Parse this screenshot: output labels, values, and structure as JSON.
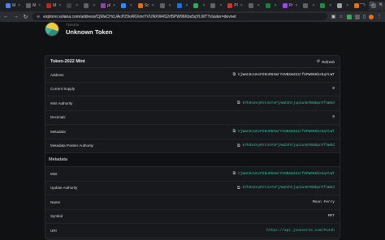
{
  "browser": {
    "tabs": [
      {
        "label": "M",
        "color": "#4285f4"
      },
      {
        "label": "M",
        "color": "#5f6368"
      },
      {
        "label": "M",
        "color": "#c5221f"
      },
      {
        "label": "",
        "color": "#3c4043"
      },
      {
        "label": "",
        "color": "#5f6368"
      },
      {
        "label": "pl",
        "color": "#8e44ad"
      },
      {
        "label": "",
        "color": "#2d8cff"
      },
      {
        "label": "Sc",
        "color": "#e37400"
      },
      {
        "label": "",
        "color": "#5f6368"
      },
      {
        "label": "",
        "color": "#1a73e8"
      },
      {
        "label": "",
        "color": "#34a853"
      },
      {
        "label": "",
        "color": "#5f6368"
      },
      {
        "label": "Pl",
        "color": "#d93025"
      },
      {
        "label": "",
        "color": "#5f6368"
      },
      {
        "label": "",
        "color": "#188038"
      },
      {
        "label": "Pr",
        "color": "#a142f4"
      },
      {
        "label": "",
        "color": "#5f6368"
      },
      {
        "label": "",
        "color": "#1e8e3e"
      },
      {
        "label": "",
        "color": "#9aa0a6"
      },
      {
        "label": "",
        "color": "#e8710a"
      },
      {
        "label": "",
        "color": "#5f6368"
      }
    ],
    "url": "explorer.solana.com/address/CjWaCHcUAcPZ9oR6XmrYVUNXW4S2rf5PW96Kbs5qYLWT?cluster=devnet"
  },
  "token": {
    "kicker": "TOKEN",
    "title": "Unknown Token"
  },
  "card": {
    "title": "Token-2022 Mint",
    "refresh_label": "Refresh",
    "rows": [
      {
        "label": "Address",
        "value": "CjWaCHcUAcPZ9oR6XmrYVUNXW4S2rf5PW96Kbs5qYLWT",
        "link": false
      },
      {
        "label": "Current Supply",
        "value": "0",
        "link": false
      },
      {
        "label": "Mint Authority",
        "value": "G7kDeZvyRzt4xYnFjAmZohtjup1a4UYBmbpnTf4WGd",
        "link": true
      },
      {
        "label": "Decimals",
        "value": "9",
        "link": false
      },
      {
        "label": "Metadata",
        "value": "CjWaCHcUAcPZ9oR6XmrYVUNXW4S2rf5PW96Kbs5qYLWT",
        "link": true
      },
      {
        "label": "Metadata Pointer Authority",
        "value": "G7kDeZvyRzt4xYnFjAmZohtjup1a4UYBmbpnTf4WGd",
        "link": true
      }
    ],
    "metadata_section": "Metadata",
    "metadata_rows": [
      {
        "label": "Mint",
        "value": "CjWaCHcUAcPZ9oR6XmrYVUNXW4S2rf5PW96Kbs5qYLWT",
        "link": true
      },
      {
        "label": "Update Authority",
        "value": "G7kDeZvyRzt4xYnFjAmZohtjup1a4UYBmbpnTf4WGd",
        "link": true
      },
      {
        "label": "Name",
        "value": "Moon Ferry",
        "link": false
      },
      {
        "label": "Symbol",
        "value": "MFT",
        "link": false
      },
      {
        "label": "URI",
        "value": "https://api.jsonserve.com/Ps4Jh",
        "link": true
      }
    ]
  }
}
